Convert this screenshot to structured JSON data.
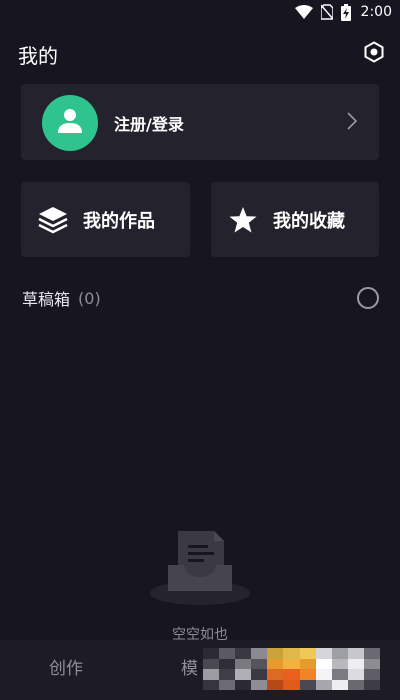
{
  "status_bar": {
    "time": "2:00",
    "icons": [
      "wifi-icon",
      "no-sim-icon",
      "battery-charging-icon"
    ]
  },
  "header": {
    "title": "我的",
    "settings_icon": "settings-hexagon-icon"
  },
  "login_card": {
    "label": "注册/登录",
    "avatar_icon": "user-icon",
    "avatar_color": "#2fc38d",
    "arrow_icon": "chevron-right-icon"
  },
  "tiles": [
    {
      "label": "我的作品",
      "icon": "layers-icon"
    },
    {
      "label": "我的收藏",
      "icon": "star-icon"
    }
  ],
  "drafts": {
    "label": "草稿箱",
    "count": "(0)"
  },
  "empty_state": {
    "text": "空空如也",
    "icon": "empty-inbox-icon"
  },
  "bottom_nav": {
    "items": [
      {
        "label": "创作"
      },
      {
        "label": "模"
      }
    ]
  },
  "colors": {
    "background": "#17151f",
    "card": "#24232d",
    "accent_green": "#2fc38d",
    "nav_background": "#1d1c25"
  }
}
